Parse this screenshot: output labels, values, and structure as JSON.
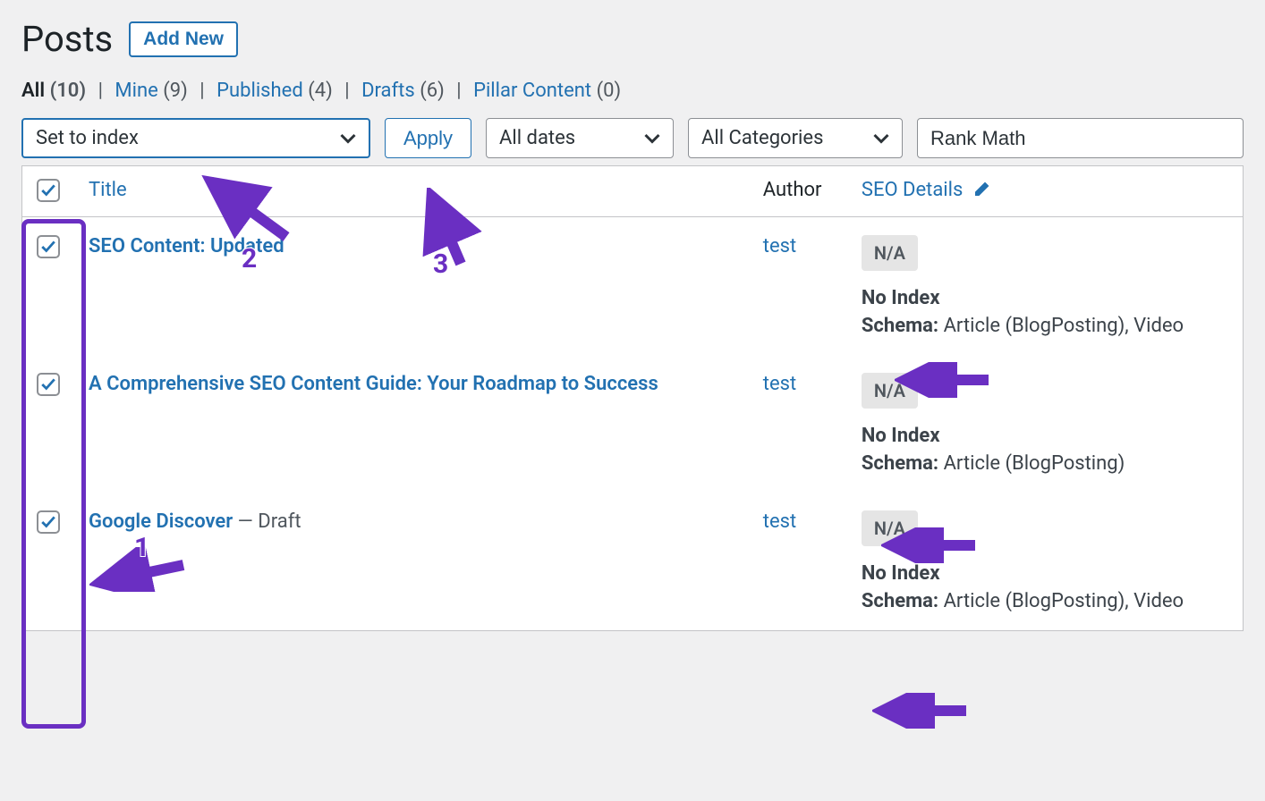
{
  "page": {
    "title": "Posts",
    "add_new": "Add New"
  },
  "filters": {
    "all": {
      "label": "All",
      "count": "(10)"
    },
    "mine": {
      "label": "Mine",
      "count": "(9)"
    },
    "published": {
      "label": "Published",
      "count": "(4)"
    },
    "drafts": {
      "label": "Drafts",
      "count": "(6)"
    },
    "pillar": {
      "label": "Pillar Content",
      "count": "(0)"
    }
  },
  "toolbar": {
    "bulk_action_value": "Set to index",
    "apply_label": "Apply",
    "dates_value": "All dates",
    "categories_value": "All Categories",
    "search_value": "Rank Math"
  },
  "columns": {
    "title": "Title",
    "author": "Author",
    "seo": "SEO Details"
  },
  "rows": [
    {
      "title": "SEO Content: Updated",
      "draft": "",
      "author": "test",
      "seo_badge": "N/A",
      "seo_status": "No Index",
      "schema_label": "Schema:",
      "schema_value": " Article (BlogPosting), Video"
    },
    {
      "title": "A Comprehensive SEO Content Guide: Your Roadmap to Success",
      "draft": "",
      "author": "test",
      "seo_badge": "N/A",
      "seo_status": "No Index",
      "schema_label": "Schema:",
      "schema_value": " Article (BlogPosting)"
    },
    {
      "title": "Google Discover",
      "draft": " — Draft",
      "author": "test",
      "seo_badge": "N/A",
      "seo_status": "No Index",
      "schema_label": "Schema:",
      "schema_value": " Article (BlogPosting), Video"
    }
  ],
  "annotations": {
    "n1": "1",
    "n2": "2",
    "n3": "3"
  }
}
